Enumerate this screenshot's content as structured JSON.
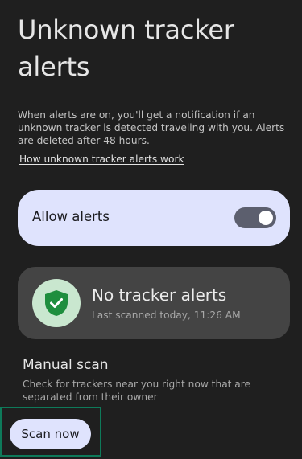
{
  "page": {
    "title": "Unknown tracker alerts",
    "description": "When alerts are on, you'll get a notification if an unknown tracker is detected traveling with you. Alerts are deleted after 48 hours.",
    "help_link": "How unknown tracker alerts work"
  },
  "allow_alerts": {
    "label": "Allow alerts",
    "enabled": true
  },
  "status": {
    "icon": "shield-check-icon",
    "title": "No tracker alerts",
    "subtitle": "Last scanned today, 11:26 AM"
  },
  "manual_scan": {
    "title": "Manual scan",
    "description": "Check for trackers near you right now that are separated from their owner",
    "button_label": "Scan now"
  },
  "colors": {
    "background": "#1f1f1f",
    "card_light": "#dfe3fd",
    "card_dark": "#444444",
    "shield_green": "#1e8e3e",
    "highlight": "#0e7a5a"
  }
}
